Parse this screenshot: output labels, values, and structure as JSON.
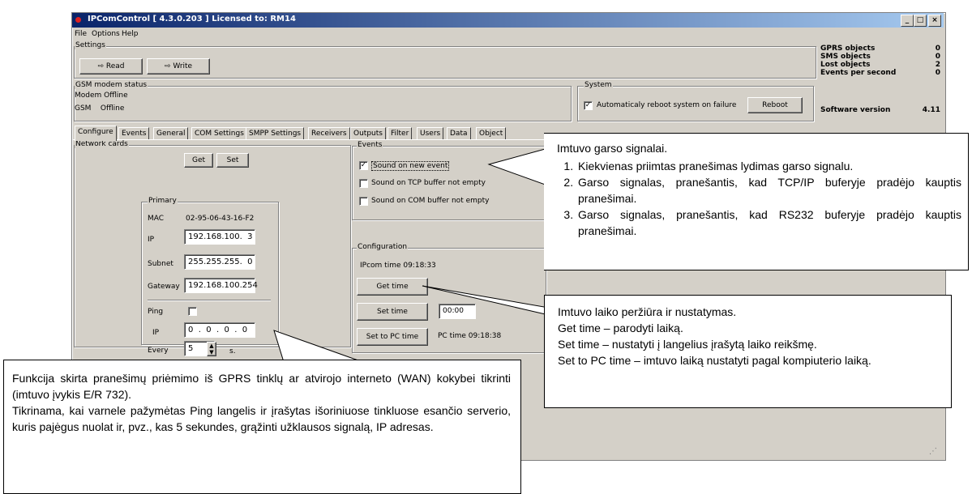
{
  "window": {
    "title": "IPComControl [ 4.3.0.203 ]  Licensed to: RM14",
    "controls": [
      "_",
      "□",
      "×"
    ]
  },
  "menu": [
    "File",
    "Options",
    "Help"
  ],
  "settings": {
    "label": "Settings",
    "read_label": "Read",
    "write_label": "Write"
  },
  "gsm": {
    "label": "GSM modem status",
    "modem": "Modem  Offline",
    "gsm": "GSM    Offline"
  },
  "system": {
    "label": "System",
    "auto_reboot": "Automaticaly reboot system on failure",
    "auto_reboot_checked": true,
    "reboot_label": "Reboot"
  },
  "stats": {
    "rows": [
      {
        "label": "GPRS objects",
        "value": "0"
      },
      {
        "label": "SMS objects",
        "value": "0"
      },
      {
        "label": "Lost objects",
        "value": "2"
      },
      {
        "label": "Events per second",
        "value": "0"
      }
    ],
    "software_version_label": "Software version",
    "software_version": "4.11"
  },
  "tabs": [
    "Configure",
    "Events",
    "General",
    "COM Settings",
    "SMPP Settings",
    "Receivers",
    "Outputs",
    "Filter",
    "Users",
    "Data",
    "Object"
  ],
  "network": {
    "label": "Network cards",
    "get_label": "Get",
    "set_label": "Set",
    "primary_label": "Primary",
    "mac_label": "MAC",
    "mac_value": "02-95-06-43-16-F2",
    "ip_label": "IP",
    "ip_value": "192.168.100.  3",
    "subnet_label": "Subnet",
    "subnet_value": "255.255.255.  0",
    "gateway_label": "Gateway",
    "gateway_value": "192.168.100.254",
    "ping_label": "Ping",
    "ping_checked": false,
    "ping_ip_label": "IP",
    "ping_ip_value": "0  .  0  .  0  .  0",
    "every_label": "Every",
    "every_value": "5",
    "every_unit": "s."
  },
  "events": {
    "label": "Events",
    "options": [
      {
        "label": "Sound on new event",
        "checked": true
      },
      {
        "label": "Sound on TCP buffer not empty",
        "checked": false
      },
      {
        "label": "Sound on COM buffer not empty",
        "checked": false
      }
    ]
  },
  "configuration": {
    "label": "Configuration",
    "ipcom_time": "IPcom time  09:18:33",
    "get_time_label": "Get time",
    "set_time_label": "Set time",
    "set_time_value": "00:00",
    "set_pc_label": "Set to PC time",
    "pc_time": "PC time  09:18:38"
  },
  "callout1": {
    "title": "Imtuvo garso signalai.",
    "items": [
      "Kiekvienas priimtas pranešimas lydimas garso signalu.",
      "Garso signalas, pranešantis, kad TCP/IP buferyje pradėjo kauptis pranešimai.",
      "Garso signalas, pranešantis, kad RS232 buferyje pradėjo kauptis pranešimai."
    ]
  },
  "callout2": {
    "lines": [
      "Imtuvo laiko peržiūra ir nustatymas.",
      "Get time – parodyti laiką.",
      "Set time – nustatyti į langelius įrašytą laiko reikšmę.",
      "Set to PC time – imtuvo laiką nustatyti pagal kompiuterio laiką."
    ]
  },
  "callout3": {
    "lines": [
      "Funkcija skirta pranešimų priėmimo iš GPRS tinklų ar atvirojo interneto (WAN) kokybei tikrinti (imtuvo įvykis E/R 732).",
      "Tikrinama, kai varnele pažymėtas Ping langelis ir įrašytas išoriniuose tinkluose esančio serverio, kuris pajėgus nuolat ir, pvz., kas 5 sekundes, grąžinti užklausos signalą, IP adresas."
    ]
  },
  "colors": {
    "titlebar_start": "#0a246a",
    "titlebar_end": "#a6caf0",
    "window_bg": "#d4d0c8"
  }
}
